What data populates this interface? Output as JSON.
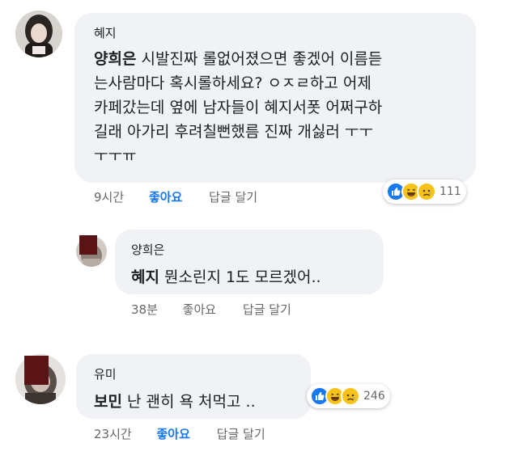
{
  "comments": [
    {
      "author": "혜지",
      "tag": "양희은",
      "text": " 시발진짜 롤없어졌으면 좋겠어 이름듣\n는사람마다  혹시롤하세요? ㅇㅈㄹ하고 어제\n카페갔는데 옆에 남자들이 혜지서폿 어쩌구하\n길래 아가리 후려칠뻔했름 진짜 개싫러 ㅜㅜ\nㅜㅜㅠ",
      "time": "9시간",
      "like": "좋아요",
      "reply": "답글 달기",
      "reactions": [
        "like-icon",
        "haha-icon",
        "sad-icon"
      ],
      "reaction_count": "111"
    },
    {
      "author": "양희은",
      "tag": "혜지",
      "text": " 뭔소린지 1도 모르겠어..",
      "time": "38분",
      "like": "좋아요",
      "reply": "답글 달기"
    },
    {
      "author": "유미",
      "tag": "보민",
      "text": " 난 괜히 욕 처먹고 ..",
      "time": "23시간",
      "like": "좋아요",
      "reply": "답글 달기",
      "reactions": [
        "like-icon",
        "haha-icon",
        "sad-icon"
      ],
      "reaction_count": "246"
    }
  ],
  "colors": {
    "accent": "#1877f2",
    "bubble": "#f0f2f5",
    "meta": "#65676b"
  }
}
